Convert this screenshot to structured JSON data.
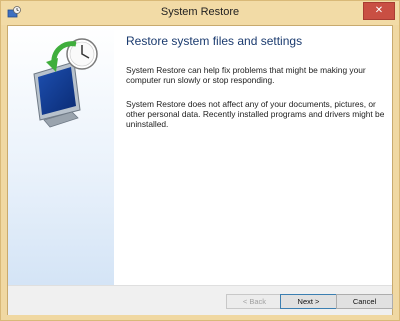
{
  "window": {
    "title": "System Restore",
    "close_glyph": "✕"
  },
  "icons": {
    "app": "system-restore-icon",
    "illustration": "system-restore-illustration"
  },
  "content": {
    "heading": "Restore system files and settings",
    "paragraph1": "System Restore can help fix problems that might be making your computer run slowly or stop responding.",
    "paragraph2": "System Restore does not affect any of your documents, pictures, or other personal data. Recently installed programs and drivers might be uninstalled."
  },
  "buttons": {
    "back": "< Back",
    "next": "Next >",
    "cancel": "Cancel"
  },
  "colors": {
    "titlebar": "#f2dba6",
    "close_button": "#c94f43",
    "heading": "#1b3b6f",
    "default_button_border": "#3c7fb1"
  }
}
